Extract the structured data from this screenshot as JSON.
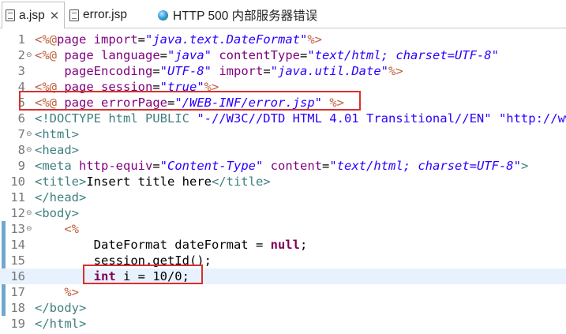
{
  "tabs": [
    {
      "label": "a.jsp",
      "icon": "jsp-file-icon",
      "active": true,
      "close": "✕"
    },
    {
      "label": "error.jsp",
      "icon": "jsp-file-icon",
      "active": false
    },
    {
      "label": "HTTP 500 内部服务器错误",
      "icon": "globe-icon",
      "active": false
    }
  ],
  "editor": {
    "line_numbers": [
      "1",
      "2",
      "3",
      "4",
      "5",
      "6",
      "7",
      "8",
      "9",
      "10",
      "11",
      "12",
      "13",
      "14",
      "15",
      "16",
      "17",
      "18",
      "19"
    ],
    "fold_markers": [
      "",
      "⊖",
      "",
      "",
      "",
      "",
      "⊖",
      "⊖",
      "",
      "",
      "",
      "⊖",
      "⊖",
      "",
      "",
      "",
      "",
      "",
      ""
    ],
    "current_line": 16,
    "lines": [
      [
        {
          "c": "t-dir",
          "t": "<%@"
        },
        {
          "c": "t-attr",
          "t": "page "
        },
        {
          "c": "t-attr",
          "t": "import"
        },
        {
          "c": "t-plain",
          "t": "="
        },
        {
          "c": "t-val",
          "t": "\"java.text.DateFormat\""
        },
        {
          "c": "t-dir",
          "t": "%>"
        }
      ],
      [
        {
          "c": "t-dir",
          "t": "<%@ "
        },
        {
          "c": "t-attr",
          "t": "page "
        },
        {
          "c": "t-attr",
          "t": "language"
        },
        {
          "c": "t-plain",
          "t": "="
        },
        {
          "c": "t-val",
          "t": "\"java\""
        },
        {
          "c": "t-plain",
          "t": " "
        },
        {
          "c": "t-attr",
          "t": "contentType"
        },
        {
          "c": "t-plain",
          "t": "="
        },
        {
          "c": "t-val",
          "t": "\"text/html; charset=UTF-8\""
        }
      ],
      [
        {
          "c": "t-plain",
          "t": "    "
        },
        {
          "c": "t-attr",
          "t": "pageEncoding"
        },
        {
          "c": "t-plain",
          "t": "="
        },
        {
          "c": "t-val",
          "t": "\"UTF-8\""
        },
        {
          "c": "t-plain",
          "t": " "
        },
        {
          "c": "t-attr",
          "t": "import"
        },
        {
          "c": "t-plain",
          "t": "="
        },
        {
          "c": "t-val",
          "t": "\"java.util.Date\""
        },
        {
          "c": "t-dir",
          "t": "%>"
        }
      ],
      [
        {
          "c": "t-dir",
          "t": "<%@ "
        },
        {
          "c": "t-attr",
          "t": "page "
        },
        {
          "c": "t-attr",
          "t": "session"
        },
        {
          "c": "t-plain",
          "t": "="
        },
        {
          "c": "t-val",
          "t": "\"true\""
        },
        {
          "c": "t-dir",
          "t": "%>"
        }
      ],
      [
        {
          "c": "t-dir",
          "t": "<%@ "
        },
        {
          "c": "t-attr",
          "t": "page "
        },
        {
          "c": "t-attr",
          "t": "errorPage"
        },
        {
          "c": "t-plain",
          "t": "="
        },
        {
          "c": "t-val",
          "t": "\"/WEB-INF/error.jsp\""
        },
        {
          "c": "t-plain",
          "t": " "
        },
        {
          "c": "t-dir",
          "t": "%>"
        }
      ],
      [
        {
          "c": "t-doc",
          "t": "<!DOCTYPE html PUBLIC "
        },
        {
          "c": "t-docstr",
          "t": "\"-//W3C//DTD HTML 4.01 Transitional//EN\""
        },
        {
          "c": "t-plain",
          "t": " "
        },
        {
          "c": "t-docstr",
          "t": "\"http://www."
        }
      ],
      [
        {
          "c": "t-tag",
          "t": "<html>"
        }
      ],
      [
        {
          "c": "t-tag",
          "t": "<head>"
        }
      ],
      [
        {
          "c": "t-tag",
          "t": "<meta "
        },
        {
          "c": "t-attr",
          "t": "http-equiv"
        },
        {
          "c": "t-plain",
          "t": "="
        },
        {
          "c": "t-val",
          "t": "\"Content-Type\""
        },
        {
          "c": "t-plain",
          "t": " "
        },
        {
          "c": "t-attr",
          "t": "content"
        },
        {
          "c": "t-plain",
          "t": "="
        },
        {
          "c": "t-val",
          "t": "\"text/html; charset=UTF-8\""
        },
        {
          "c": "t-tag",
          "t": ">"
        }
      ],
      [
        {
          "c": "t-tag",
          "t": "<title>"
        },
        {
          "c": "t-plain",
          "t": "Insert title here"
        },
        {
          "c": "t-tag",
          "t": "</title>"
        }
      ],
      [
        {
          "c": "t-tag",
          "t": "</head>"
        }
      ],
      [
        {
          "c": "t-tag",
          "t": "<body>"
        }
      ],
      [
        {
          "c": "t-plain",
          "t": "    "
        },
        {
          "c": "t-dir",
          "t": "<%"
        }
      ],
      [
        {
          "c": "t-plain",
          "t": "        DateFormat dateFormat = "
        },
        {
          "c": "t-kw",
          "t": "null"
        },
        {
          "c": "t-plain",
          "t": ";"
        }
      ],
      [
        {
          "c": "t-plain",
          "t": "        session.getId();"
        }
      ],
      [
        {
          "c": "t-plain",
          "t": "        "
        },
        {
          "c": "t-kw",
          "t": "int"
        },
        {
          "c": "t-plain",
          "t": " i = 10/0;"
        }
      ],
      [
        {
          "c": "t-plain",
          "t": "    "
        },
        {
          "c": "t-dir",
          "t": "%>"
        }
      ],
      [
        {
          "c": "t-tag",
          "t": "</body>"
        }
      ],
      [
        {
          "c": "t-tag",
          "t": "</html>"
        }
      ]
    ]
  },
  "colors": {
    "directive": "#bf5f3f",
    "tag": "#3f7f7f",
    "attribute": "#7f007f",
    "string": "#2a00ff",
    "keyword": "#7f0055",
    "highlight_box": "#d9302e",
    "current_line_bg": "#e8f2fe"
  }
}
